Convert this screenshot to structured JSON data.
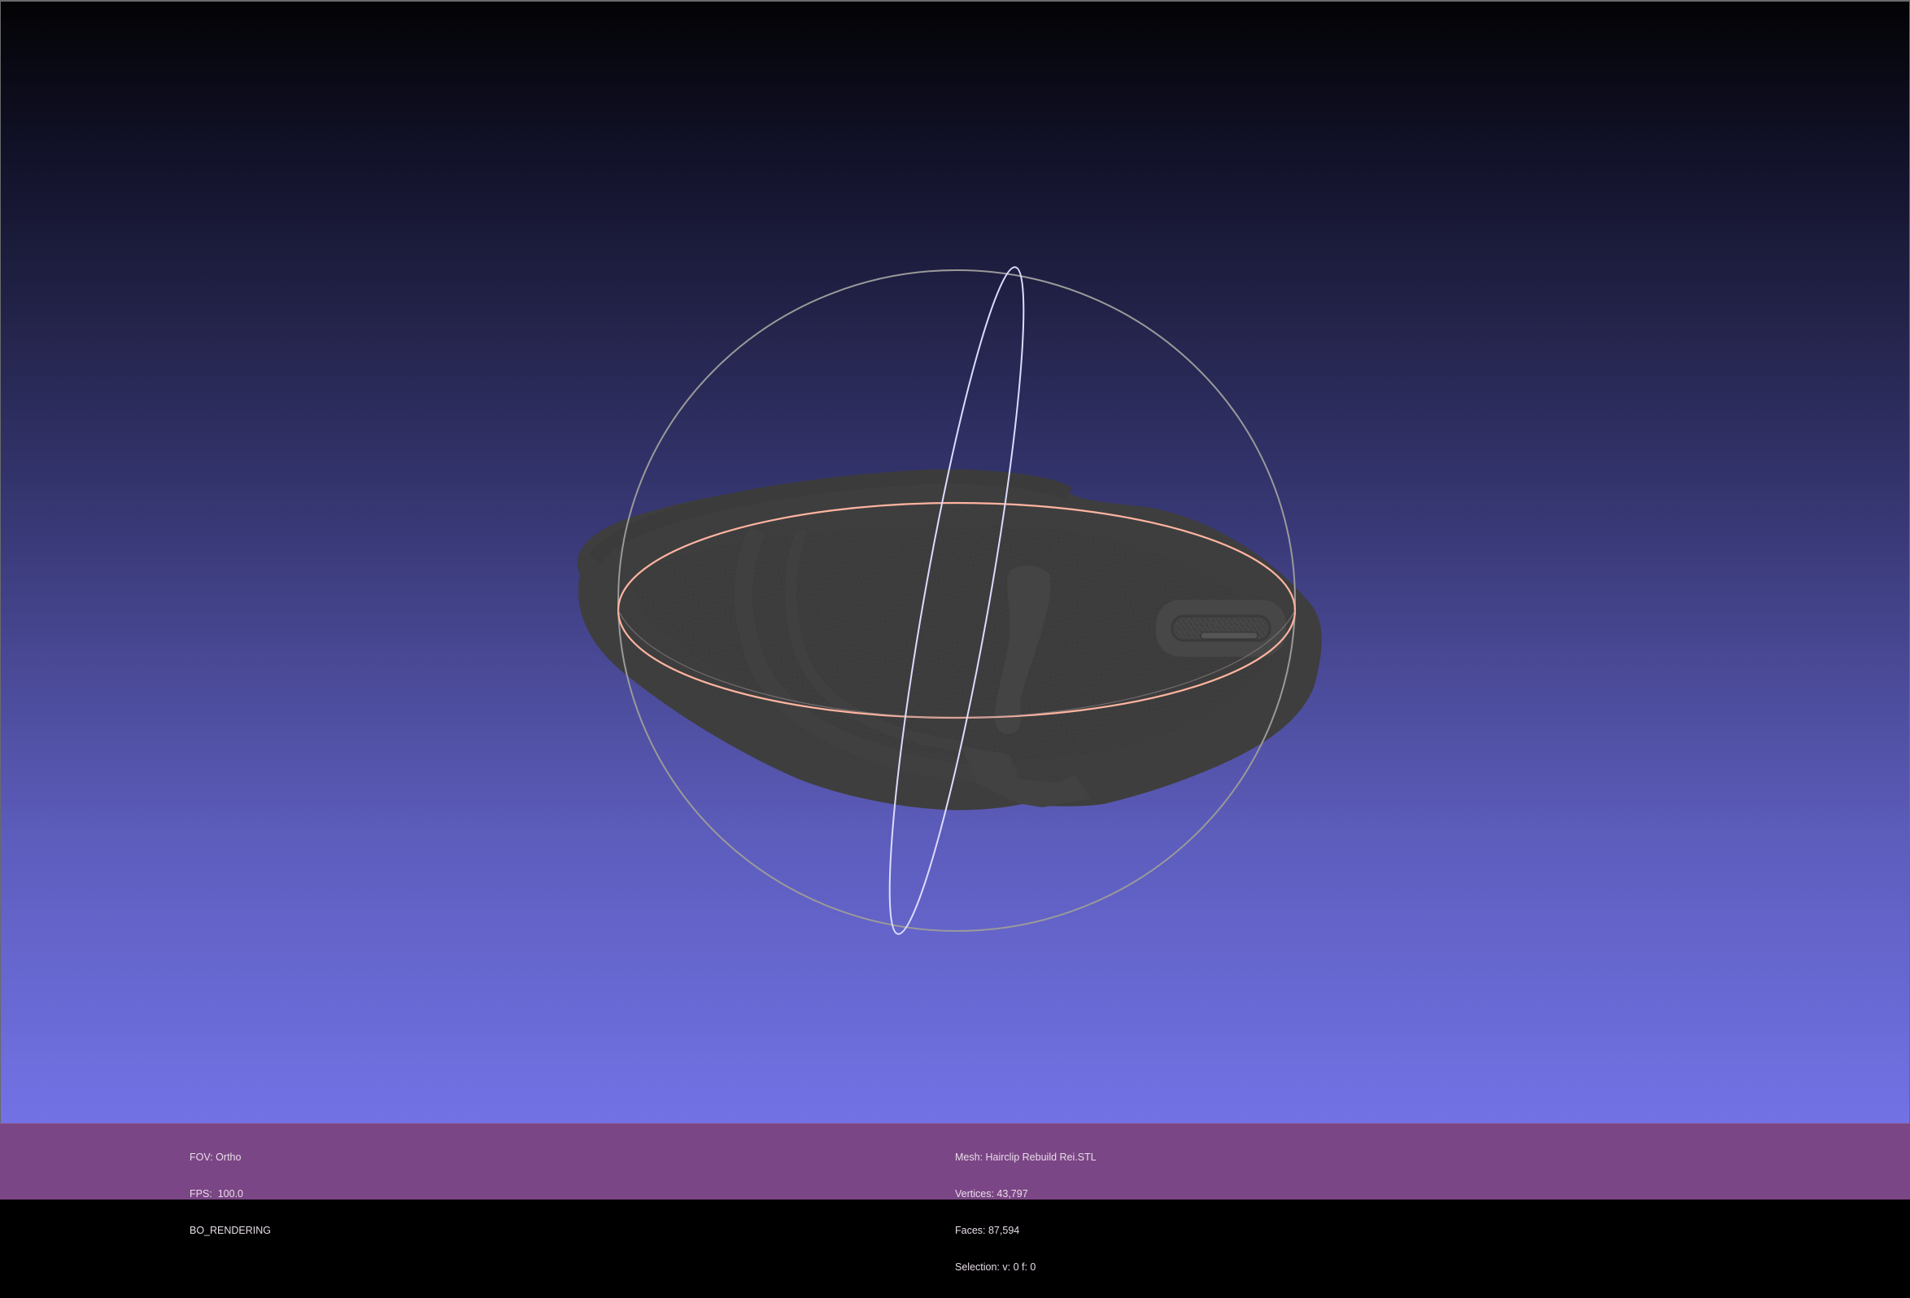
{
  "viewport": {
    "background_top": "#030305",
    "background_bottom": "#7272e6",
    "mesh_color": "#3f3f3f",
    "trackball_ring_color": "#9a9a9a",
    "highlight_ring_color": "#ffb4a0",
    "vertical_ring_color": "#dcdcff"
  },
  "info_left": {
    "fov": "FOV: Ortho",
    "fps": "FPS:  100.0",
    "rendering": "BO_RENDERING"
  },
  "info_right": {
    "mesh": "Mesh: Hairclip Rebuild Rei.STL",
    "vertices": "Vertices: 43,797",
    "faces": "Faces: 87,594",
    "selection": "Selection: v: 0 f: 0"
  },
  "infobar_color": "#7b4685"
}
